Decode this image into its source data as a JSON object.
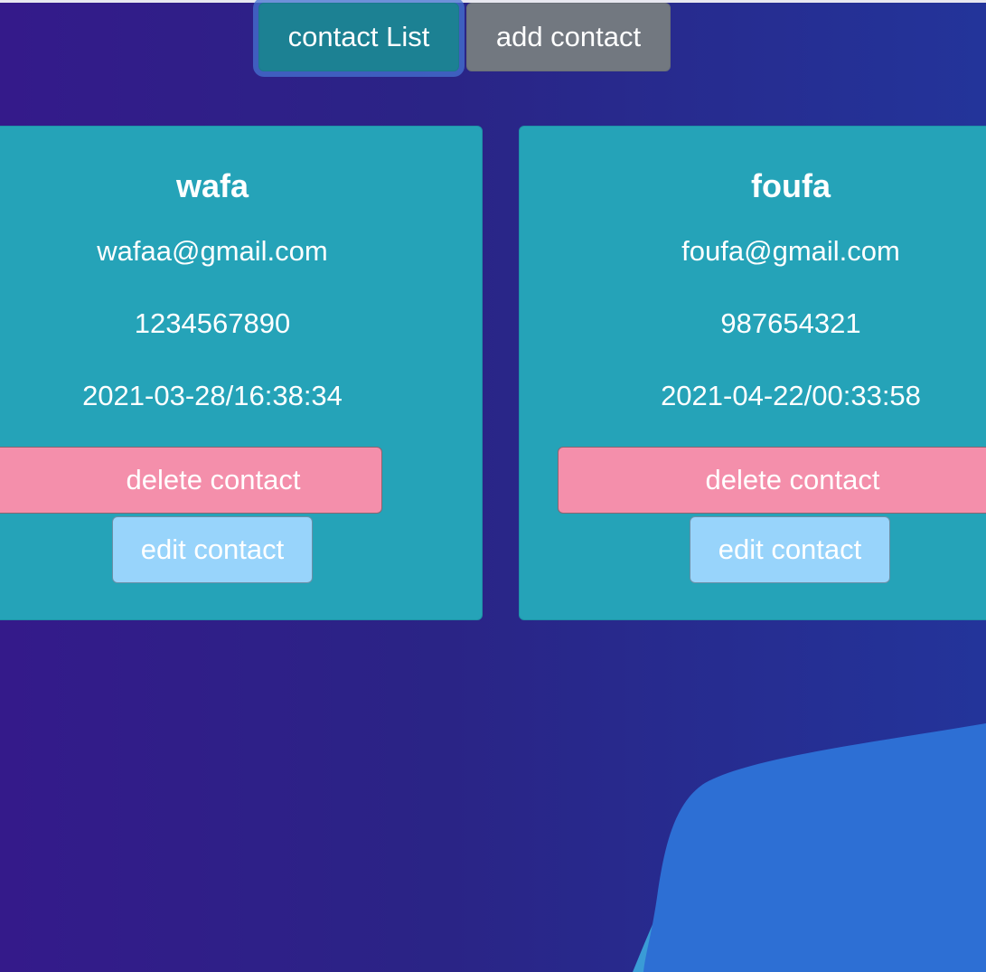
{
  "nav": {
    "contact_list_label": "contact List",
    "add_contact_label": "add contact"
  },
  "contacts": [
    {
      "name": "wafa",
      "email": "wafaa@gmail.com",
      "phone": "1234567890",
      "date": "2021-03-28/16:38:34",
      "delete_label": "delete contact",
      "edit_label": "edit contact"
    },
    {
      "name": "foufa",
      "email": "foufa@gmail.com",
      "phone": "987654321",
      "date": "2021-04-22/00:33:58",
      "delete_label": "delete contact",
      "edit_label": "edit contact"
    }
  ],
  "colors": {
    "background_left": "#341a8a",
    "background_right": "#23349a",
    "card": "#25a3b8",
    "nav_active": "#1c8193",
    "nav_secondary": "#727880",
    "delete_button": "#f48fab",
    "edit_button": "#98d4fb",
    "wave": "#2d6fd4"
  }
}
